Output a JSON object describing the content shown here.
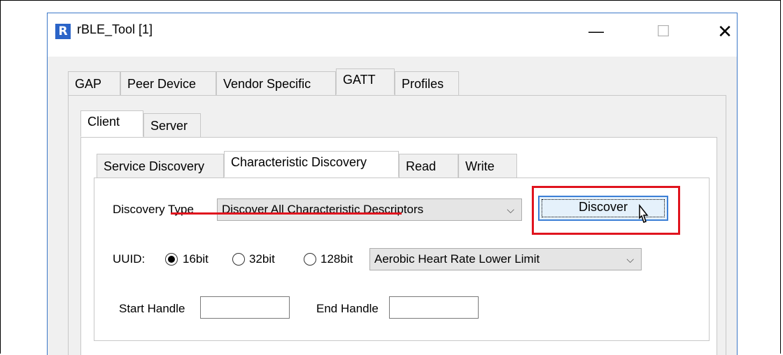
{
  "window": {
    "title": "rBLE_Tool [1]",
    "app_icon": "R",
    "controls": {
      "minimize": "—",
      "maximize": "☐",
      "close": "✕"
    }
  },
  "main_tabs": [
    "GAP",
    "Peer Device",
    "Vendor Specific",
    "GATT",
    "Profiles"
  ],
  "main_tabs_active": "GATT",
  "sub_tabs": [
    "Client",
    "Server"
  ],
  "sub_tabs_active": "Client",
  "client_tabs": [
    "Service Discovery",
    "Characteristic Discovery",
    "Read",
    "Write"
  ],
  "client_tabs_active": "Characteristic Discovery",
  "form": {
    "discovery_type_label": "Discovery Type",
    "discovery_type_value": "Discover All Characteristic Descriptors",
    "discover_button": "Discover",
    "uuid_label": "UUID:",
    "uuid_options": [
      "16bit",
      "32bit",
      "128bit"
    ],
    "uuid_selected": "16bit",
    "uuid_value": "Aerobic Heart Rate Lower Limit",
    "start_handle_label": "Start Handle",
    "start_handle_value": "",
    "end_handle_label": "End Handle",
    "end_handle_value": ""
  },
  "colors": {
    "highlight": "#e0141e",
    "button_border": "#3c7fd6",
    "button_fill": "#e5f1fb"
  }
}
